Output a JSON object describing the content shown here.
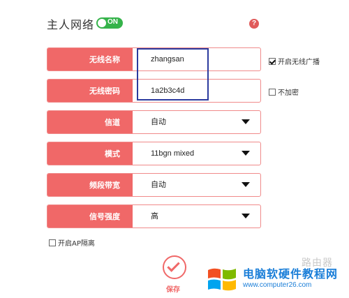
{
  "header": {
    "title": "主人网络",
    "toggle_label": "ON",
    "help_symbol": "?"
  },
  "rows": [
    {
      "label": "无线名称",
      "value": "zhangsan",
      "dropdown": false
    },
    {
      "label": "无线密码",
      "value": "1a2b3c4d",
      "dropdown": false
    },
    {
      "label": "信道",
      "value": "自动",
      "dropdown": true
    },
    {
      "label": "模式",
      "value": "11bgn mixed",
      "dropdown": true
    },
    {
      "label": "频段带宽",
      "value": "自动",
      "dropdown": true
    },
    {
      "label": "信号强度",
      "value": "高",
      "dropdown": true
    }
  ],
  "options": {
    "broadcast": {
      "label": "开启无线广播",
      "checked": true
    },
    "no_encrypt": {
      "label": "不加密",
      "checked": false
    },
    "ap_isolation": {
      "label": "开启AP隔离",
      "checked": false
    }
  },
  "actions": {
    "save_label": "保存"
  },
  "watermark": {
    "title": "电脑软硬件教程网",
    "url": "www.computer26.com",
    "ghost_text": "路由器"
  },
  "colors": {
    "accent": "#f06868",
    "toggle_on": "#35b34a",
    "highlight_box": "#2b3a9e",
    "watermark": "#1a7ed8"
  }
}
